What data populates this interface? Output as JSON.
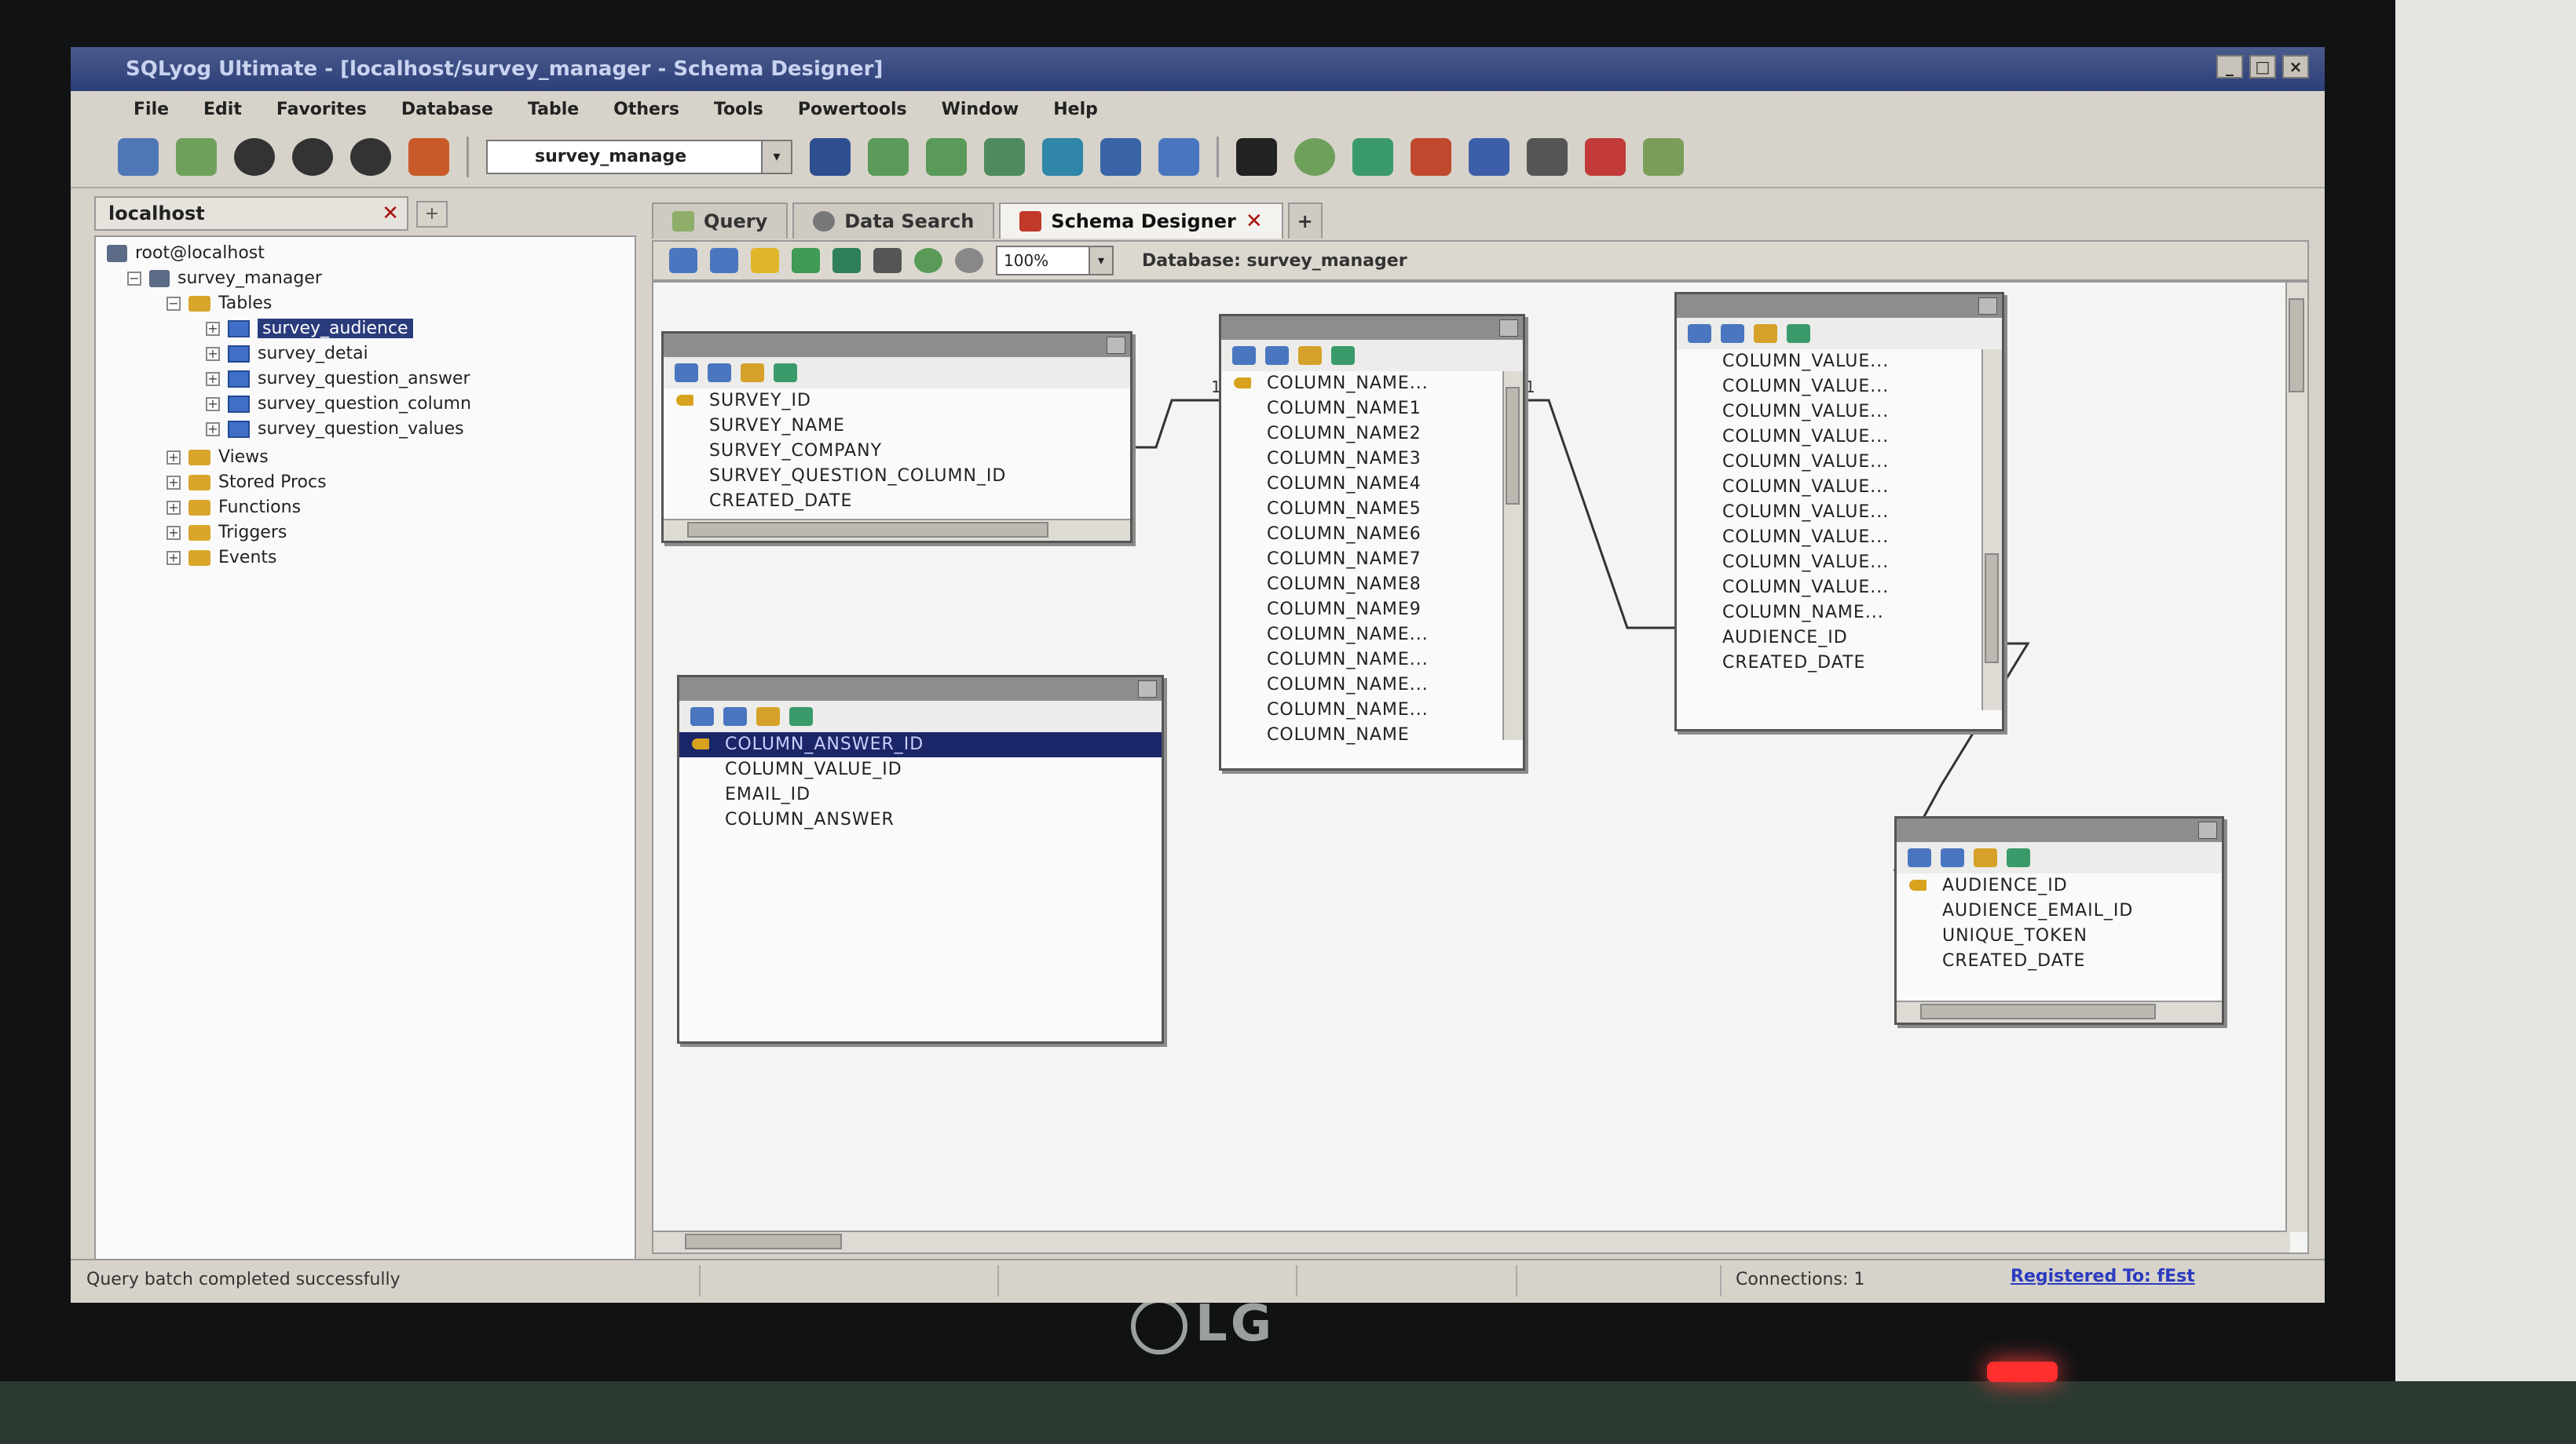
{
  "window": {
    "title": "SQLyog Ultimate - [localhost/survey_manager - Schema Designer]"
  },
  "menu": [
    "File",
    "Edit",
    "Favorites",
    "Database",
    "Table",
    "Others",
    "Tools",
    "Powertools",
    "Window",
    "Help"
  ],
  "toolbar": {
    "database_select": "survey_manage"
  },
  "connection_tab": {
    "label": "localhost"
  },
  "tree": {
    "root": "root@localhost",
    "database": "survey_manager",
    "tables_label": "Tables",
    "tables": [
      "survey_audience",
      "survey_detai",
      "survey_question_answer",
      "survey_question_column",
      "survey_question_values"
    ],
    "folders": [
      "Views",
      "Stored Procs",
      "Functions",
      "Triggers",
      "Events"
    ]
  },
  "main_tabs": [
    "Query",
    "Data Search",
    "Schema Designer"
  ],
  "designer": {
    "zoom": "100%",
    "database_label": "Database: survey_manager"
  },
  "schema_tables": [
    {
      "columns": [
        "SURVEY_ID",
        "SURVEY_NAME",
        "SURVEY_COMPANY",
        "SURVEY_QUESTION_COLUMN_ID",
        "CREATED_DATE"
      ]
    },
    {
      "columns": [
        "COLUMN_NAME...",
        "COLUMN_NAME1",
        "COLUMN_NAME2",
        "COLUMN_NAME3",
        "COLUMN_NAME4",
        "COLUMN_NAME5",
        "COLUMN_NAME6",
        "COLUMN_NAME7",
        "COLUMN_NAME8",
        "COLUMN_NAME9",
        "COLUMN_NAME...",
        "COLUMN_NAME...",
        "COLUMN_NAME...",
        "COLUMN_NAME...",
        "COLUMN_NAME"
      ]
    },
    {
      "columns": [
        "COLUMN_VALUE...",
        "COLUMN_VALUE...",
        "COLUMN_VALUE...",
        "COLUMN_VALUE...",
        "COLUMN_VALUE...",
        "COLUMN_VALUE...",
        "COLUMN_VALUE...",
        "COLUMN_VALUE...",
        "COLUMN_VALUE...",
        "COLUMN_VALUE...",
        "COLUMN_NAME...",
        "AUDIENCE_ID",
        "CREATED_DATE"
      ]
    },
    {
      "columns": [
        "COLUMN_ANSWER_ID",
        "COLUMN_VALUE_ID",
        "EMAIL_ID",
        "COLUMN_ANSWER"
      ]
    },
    {
      "columns": [
        "AUDIENCE_ID",
        "AUDIENCE_EMAIL_ID",
        "UNIQUE_TOKEN",
        "CREATED_DATE"
      ]
    }
  ],
  "relations": {
    "label_1": "1",
    "label_2": "1"
  },
  "statusbar": {
    "message": "Query batch completed successfully",
    "connections": "Connections: 1",
    "registered": "Registered To: fEst"
  },
  "monitor": {
    "brand": "LG"
  },
  "colors": {
    "titlebar": "#2c3f78",
    "selection": "#1b2668",
    "key": "#d8a21f"
  }
}
